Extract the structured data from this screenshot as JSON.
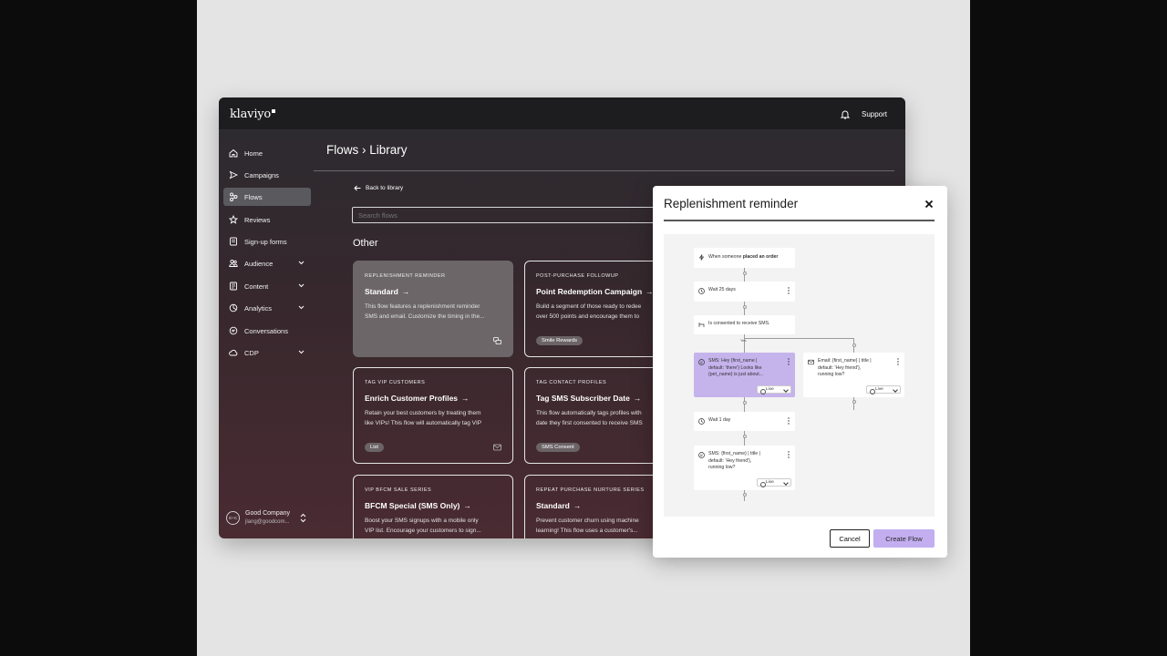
{
  "app": {
    "logo": "klaviyo",
    "support_label": "Support"
  },
  "sidebar": {
    "items": [
      {
        "label": "Home",
        "icon": "home-icon"
      },
      {
        "label": "Campaigns",
        "icon": "send-icon"
      },
      {
        "label": "Flows",
        "icon": "flows-icon",
        "active": true
      },
      {
        "label": "Reviews",
        "icon": "star-icon"
      },
      {
        "label": "Sign-up forms",
        "icon": "form-icon"
      },
      {
        "label": "Audience",
        "icon": "audience-icon",
        "expandable": true
      },
      {
        "label": "Content",
        "icon": "content-icon",
        "expandable": true
      },
      {
        "label": "Analytics",
        "icon": "analytics-icon",
        "expandable": true
      },
      {
        "label": "Conversations",
        "icon": "chat-icon"
      },
      {
        "label": "CDP",
        "icon": "cloud-icon",
        "expandable": true
      }
    ],
    "account": {
      "avatar": "G+C",
      "name": "Good Company",
      "email": "jlang@goodcom..."
    }
  },
  "main": {
    "breadcrumb": "Flows › Library",
    "back_label": "Back to library",
    "search_placeholder": "Search flows",
    "section_title": "Other",
    "cards": [
      {
        "eyebrow": "REPLENISHMENT REMINDER",
        "title": "Standard",
        "desc": "This flow features a replenishment reminder\nSMS and email. Customize the timing in the...",
        "chip": "",
        "icon": "sms-email-icon"
      },
      {
        "eyebrow": "POST-PURCHASE FOLLOWUP",
        "title": "Point Redemption Campaign",
        "desc": "Build a segment of those ready to redee\nover 500 points and encourage them to",
        "chip": "Smile Rewards",
        "icon": ""
      },
      {
        "eyebrow": "TAG VIP CUSTOMERS",
        "title": "Enrich Customer Profiles",
        "desc": "Retain your best customers by treating them\nlike VIPs! This flow will automatically tag VIP",
        "chip": "List",
        "icon": "email-icon"
      },
      {
        "eyebrow": "TAG CONTACT PROFILES",
        "title": "Tag SMS Subscriber Date",
        "desc": "This flow automatically tags profiles with\ndate they first consented to receive SMS",
        "chip": "SMS Consent",
        "icon": ""
      },
      {
        "eyebrow": "VIP BFCM SALE SERIES",
        "title": "BFCM Special (SMS Only)",
        "desc": "Boost your SMS signups with a mobile only\nVIP list. Encourage your customers to sign...",
        "chip": "",
        "icon": ""
      },
      {
        "eyebrow": "REPEAT PURCHASE NURTURE SERIES",
        "title": "Standard",
        "desc": "Prevent customer churn using machine\nlearning! This flow uses a customer's...",
        "chip": "",
        "icon": ""
      }
    ]
  },
  "modal": {
    "title": "Replenishment reminder",
    "trigger_prefix": "When someone ",
    "trigger_bold": "placed an order",
    "wait1": "Wait 25 days",
    "condition": "Is consented to receive SMS.",
    "split_yes": "Yes",
    "split_no": "No",
    "sms1": "SMS: Hey {first_name |\ndefault: 'there'} Looks like\n{pet_name} is just about...",
    "email1": "Email: {first_name} | title |\ndefault: 'Hey friend'},\nrunning low?",
    "wait2": "Wait 1 day",
    "sms2": "SMS: {first_name} | title |\ndefault: 'Hey friend'},\nrunning low?",
    "live_label": "Live",
    "cancel_label": "Cancel",
    "create_label": "Create Flow"
  },
  "colors": {
    "accent": "#c3aef0",
    "node_purple": "#c5b3ec",
    "sidebar_active": "#5a5a5e"
  }
}
